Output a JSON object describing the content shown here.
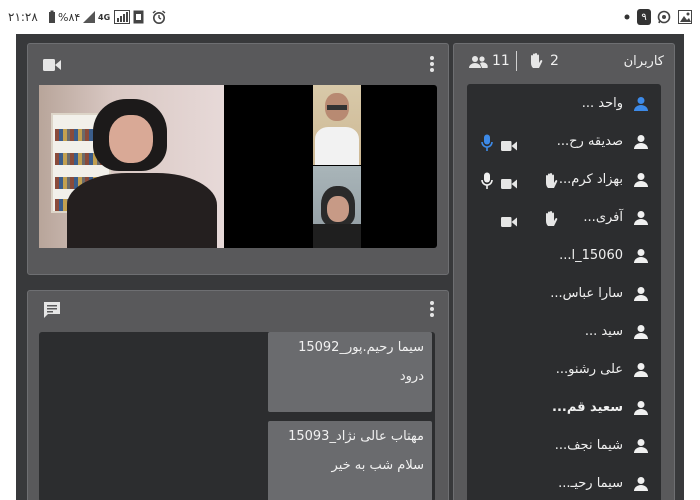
{
  "statusbar": {
    "time": "۲۱:۲۸",
    "battery": "%۸۴",
    "network": "4G",
    "notification_count": "۹"
  },
  "video_panel": {
    "camera_icon": "video-camera-icon",
    "menu_icon": "kebab-menu-icon"
  },
  "chat_panel": {
    "chat_icon": "chat-icon",
    "menu_icon": "kebab-menu-icon",
    "messages": [
      {
        "name": "سیما رحیم.پور_15092",
        "text": "درود"
      },
      {
        "name": "مهتاب عالی نژاد_15093",
        "text": "سلام شب به خیر"
      }
    ]
  },
  "users_panel": {
    "title": "کاربران",
    "raised_hands": "2",
    "participants": "11",
    "users": [
      {
        "name": "واحد ...",
        "self": true,
        "mic": false,
        "cam": false,
        "hand": false,
        "bold": false
      },
      {
        "name": "صدیقه رح...",
        "self": false,
        "mic": true,
        "cam": true,
        "hand": false,
        "bold": false
      },
      {
        "name": "بهزاد کرم...",
        "self": false,
        "mic": true,
        "cam": true,
        "hand": true,
        "bold": false
      },
      {
        "name": "آفری...",
        "self": false,
        "mic": false,
        "cam": true,
        "hand": true,
        "bold": false
      },
      {
        "name": "15060_ا...",
        "self": false,
        "mic": false,
        "cam": false,
        "hand": false,
        "bold": false
      },
      {
        "name": "سارا عباس...",
        "self": false,
        "mic": false,
        "cam": false,
        "hand": false,
        "bold": false
      },
      {
        "name": "سید ...",
        "self": false,
        "mic": false,
        "cam": false,
        "hand": false,
        "bold": false
      },
      {
        "name": "علی رشنو...",
        "self": false,
        "mic": false,
        "cam": false,
        "hand": false,
        "bold": false
      },
      {
        "name": "سعید قم...",
        "self": false,
        "mic": false,
        "cam": false,
        "hand": false,
        "bold": true
      },
      {
        "name": "شیما نجف...",
        "self": false,
        "mic": false,
        "cam": false,
        "hand": false,
        "bold": false
      },
      {
        "name": "سیما رحیـ...",
        "self": false,
        "mic": false,
        "cam": false,
        "hand": false,
        "bold": false
      }
    ]
  }
}
